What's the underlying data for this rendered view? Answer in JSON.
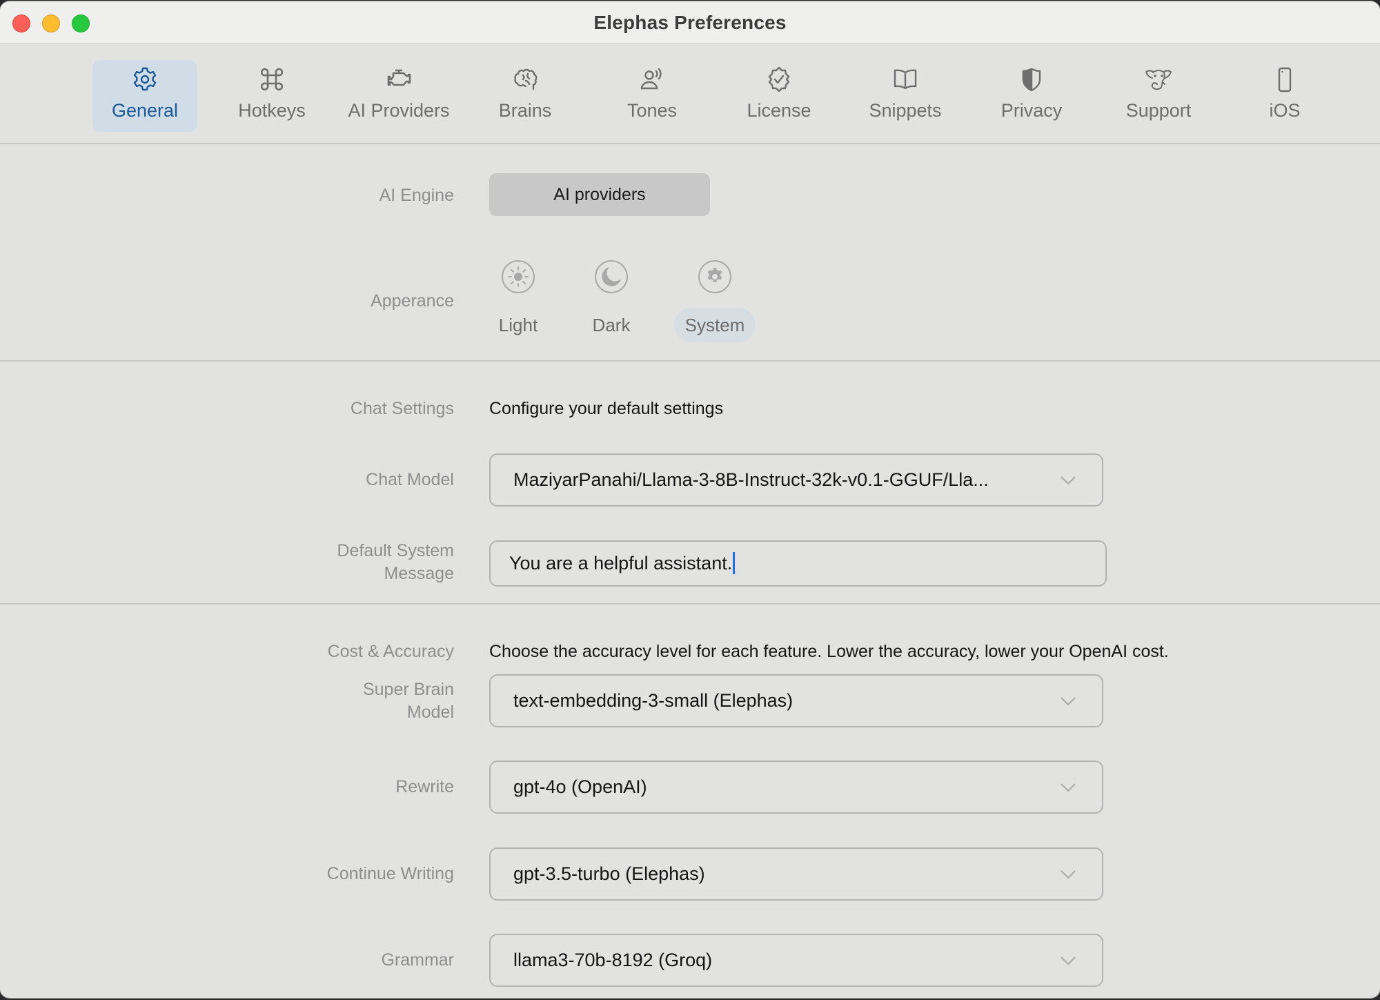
{
  "window": {
    "title": "Elephas Preferences"
  },
  "toolbar": {
    "tabs": [
      {
        "label": "General",
        "icon": "gear-icon",
        "active": true
      },
      {
        "label": "Hotkeys",
        "icon": "command-key-icon",
        "active": false
      },
      {
        "label": "AI Providers",
        "icon": "engine-icon",
        "active": false
      },
      {
        "label": "Brains",
        "icon": "brain-icon",
        "active": false
      },
      {
        "label": "Tones",
        "icon": "person-voice-icon",
        "active": false
      },
      {
        "label": "License",
        "icon": "checkmark-seal-icon",
        "active": false
      },
      {
        "label": "Snippets",
        "icon": "book-icon",
        "active": false
      },
      {
        "label": "Privacy",
        "icon": "shield-icon",
        "active": false
      },
      {
        "label": "Support",
        "icon": "elephant-icon",
        "active": false
      },
      {
        "label": "iOS",
        "icon": "iphone-icon",
        "active": false
      }
    ]
  },
  "general": {
    "ai_engine": {
      "label": "AI Engine",
      "button": "AI providers"
    },
    "appearance": {
      "label": "Apperance",
      "options": [
        {
          "label": "Light",
          "icon": "sun-icon",
          "selected": false
        },
        {
          "label": "Dark",
          "icon": "moon-icon",
          "selected": false
        },
        {
          "label": "System",
          "icon": "gear-icon",
          "selected": true
        }
      ]
    },
    "chat_settings": {
      "label": "Chat Settings",
      "description": "Configure your default settings",
      "chat_model": {
        "label": "Chat Model",
        "value": "MaziyarPanahi/Llama-3-8B-Instruct-32k-v0.1-GGUF/Lla..."
      },
      "system_message": {
        "label_line1": "Default System",
        "label_line2": "Message",
        "value": "You are a helpful assistant."
      }
    },
    "cost_accuracy": {
      "label": "Cost & Accuracy",
      "description": "Choose the accuracy level for each feature. Lower the accuracy, lower your OpenAI cost.",
      "super_brain": {
        "label_line1": "Super Brain",
        "label_line2": "Model",
        "value": "text-embedding-3-small (Elephas)"
      },
      "rewrite": {
        "label": "Rewrite",
        "value": "gpt-4o (OpenAI)"
      },
      "continue_writing": {
        "label": "Continue Writing",
        "value": "gpt-3.5-turbo (Elephas)"
      },
      "grammar": {
        "label": "Grammar",
        "value": "llama3-70b-8192 (Groq)"
      }
    }
  },
  "colors": {
    "accent": "#1b5a99",
    "active_tab_bg": "#d1dde6",
    "caret": "#1f6ff5"
  }
}
